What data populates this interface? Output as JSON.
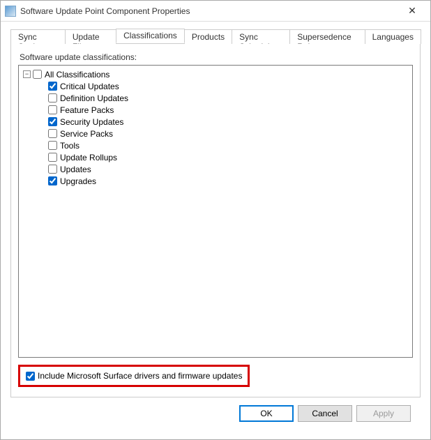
{
  "window": {
    "title": "Software Update Point Component Properties"
  },
  "tabs": [
    {
      "label": "Sync Settings"
    },
    {
      "label": "Update Files"
    },
    {
      "label": "Classifications"
    },
    {
      "label": "Products"
    },
    {
      "label": "Sync Schedule"
    },
    {
      "label": "Supersedence Rules"
    },
    {
      "label": "Languages"
    }
  ],
  "section_label": "Software update classifications:",
  "tree": {
    "root": {
      "label": "All Classifications",
      "checked": false,
      "expanded": true
    },
    "children": [
      {
        "label": "Critical Updates",
        "checked": true
      },
      {
        "label": "Definition Updates",
        "checked": false
      },
      {
        "label": "Feature Packs",
        "checked": false
      },
      {
        "label": "Security Updates",
        "checked": true
      },
      {
        "label": "Service Packs",
        "checked": false
      },
      {
        "label": "Tools",
        "checked": false
      },
      {
        "label": "Update Rollups",
        "checked": false
      },
      {
        "label": "Updates",
        "checked": false
      },
      {
        "label": "Upgrades",
        "checked": true
      }
    ]
  },
  "surface_checkbox": {
    "label": "Include Microsoft Surface drivers and firmware updates",
    "checked": true
  },
  "buttons": {
    "ok": "OK",
    "cancel": "Cancel",
    "apply": "Apply"
  }
}
